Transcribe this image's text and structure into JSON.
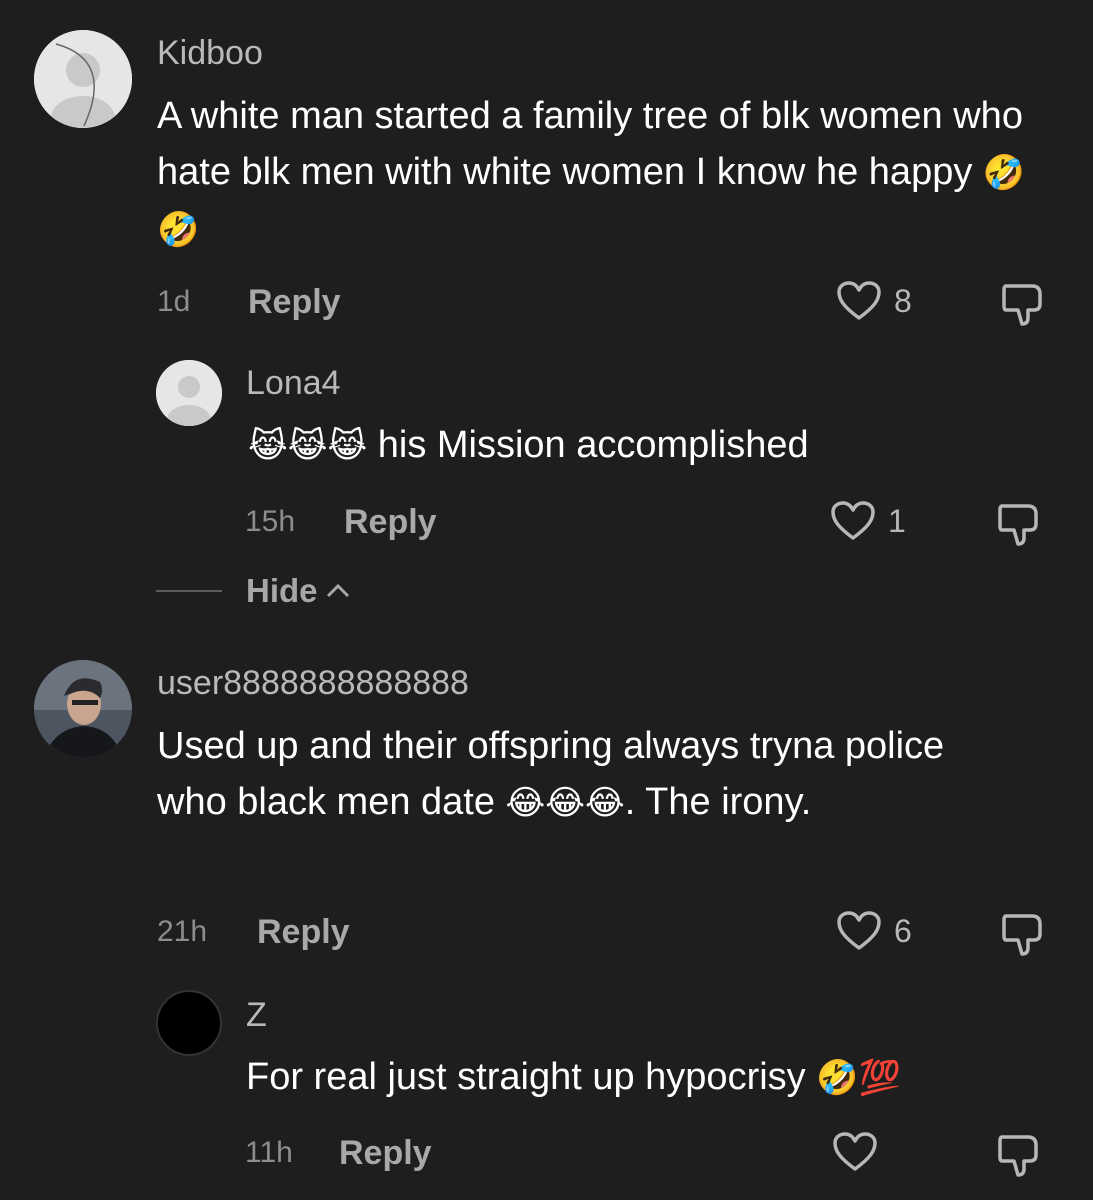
{
  "comments": [
    {
      "username": "Kidboo",
      "text": "A white man started a family tree of blk women who hate blk men with white women I know he happy",
      "emoji": "🤣🤣",
      "time": "1d",
      "reply_label": "Reply",
      "likes": "8"
    },
    {
      "username": "Lona4",
      "emoji": "😹😹😹",
      "text": "his Mission accomplished",
      "time": "15h",
      "reply_label": "Reply",
      "likes": "1"
    },
    {
      "username": "user8888888888888",
      "text_before": "Used up and their offspring always tryna police who black men date",
      "emoji": "😂😂😂",
      "text_after": ". The irony.",
      "time": "21h",
      "reply_label": "Reply",
      "likes": "6"
    },
    {
      "username": "Z",
      "text": "For real just straight up hypocrisy",
      "emoji": "🤣💯",
      "time": "11h",
      "reply_label": "Reply",
      "likes": ""
    }
  ],
  "hide_label": "Hide",
  "colors": {
    "background": "#1e1e1e",
    "username": "#b9b9b9",
    "text": "#ffffff",
    "meta": "#8d8d8d"
  },
  "icons": [
    "default-avatar-icon",
    "heart-icon",
    "dislike-icon",
    "chevron-up-icon"
  ]
}
